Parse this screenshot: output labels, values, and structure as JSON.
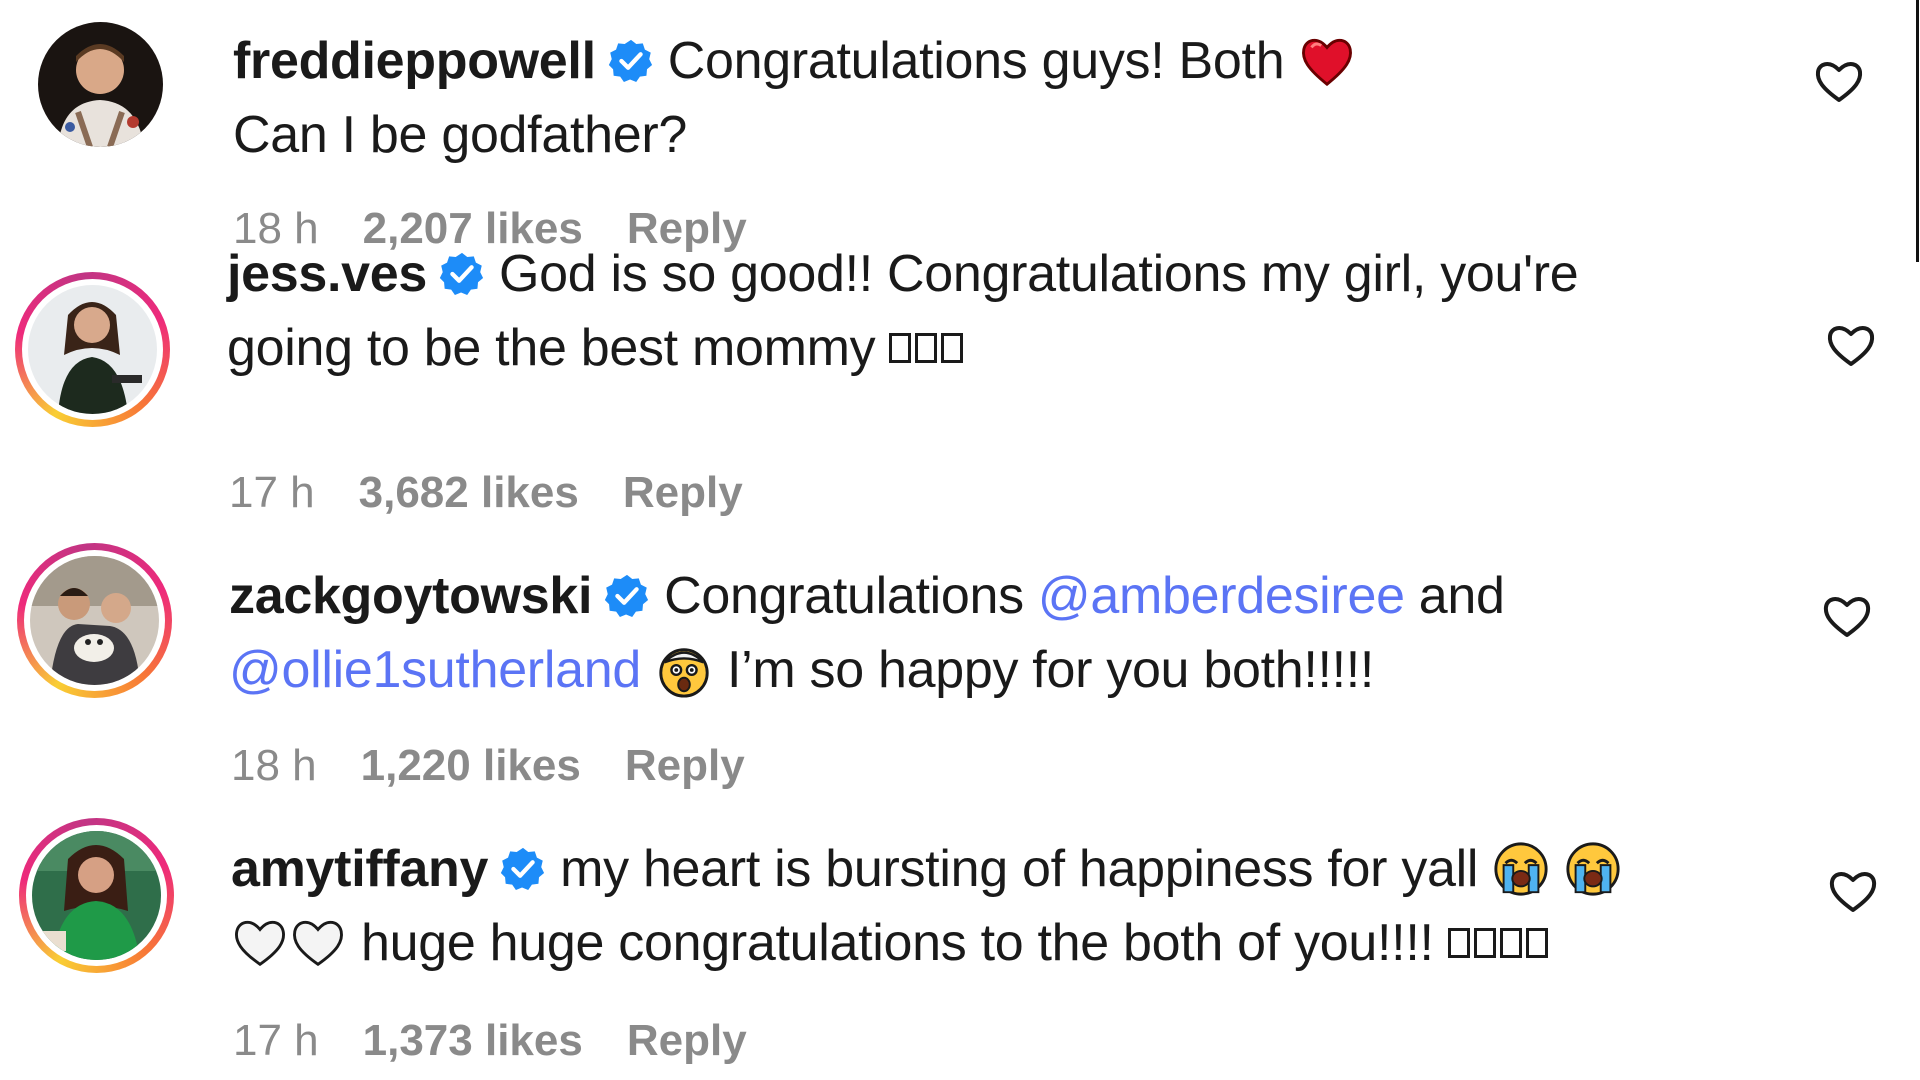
{
  "comments": [
    {
      "username": "freddieppowell",
      "line1_text": "Congratulations guys! Both",
      "line2_text": "Can I be godfather?",
      "time": "18 h",
      "likes": "2,207 likes",
      "reply": "Reply",
      "has_story_ring": false
    },
    {
      "username": "jess.ves",
      "line1_text": "God is so good!! Congratulations my girl, you're",
      "line2_text": "going to be the best mommy",
      "time": "17 h",
      "likes": "3,682 likes",
      "reply": "Reply",
      "has_story_ring": true
    },
    {
      "username": "zackgoytowski",
      "line1_text": "Congratulations",
      "mention1": "@amberdesiree",
      "line1_after": "and",
      "mention2": "@ollie1sutherland",
      "line2_text": "I’m so happy for you both!!!!!",
      "time": "18 h",
      "likes": "1,220 likes",
      "reply": "Reply",
      "has_story_ring": true
    },
    {
      "username": "amytiffany",
      "line1_text": "my heart is bursting of happiness for yall",
      "line2_text": "huge huge congratulations to the both of you!!!!",
      "time": "17 h",
      "likes": "1,373 likes",
      "reply": "Reply",
      "has_story_ring": true
    }
  ],
  "colors": {
    "text": "#1a1a1a",
    "meta": "#8a8a8a",
    "mention": "#5b74f5",
    "verified": "#1d8cf8",
    "heart_emoji": "#e0102a"
  },
  "icons": {
    "verified": "verified-badge-icon",
    "like": "heart-outline-icon",
    "red_heart_emoji": "red-heart-emoji",
    "crying_emoji": "loudly-crying-face-emoji",
    "shocked_emoji": "exploding-head-emoji",
    "white_heart_emoji": "white-heart-emoji"
  }
}
